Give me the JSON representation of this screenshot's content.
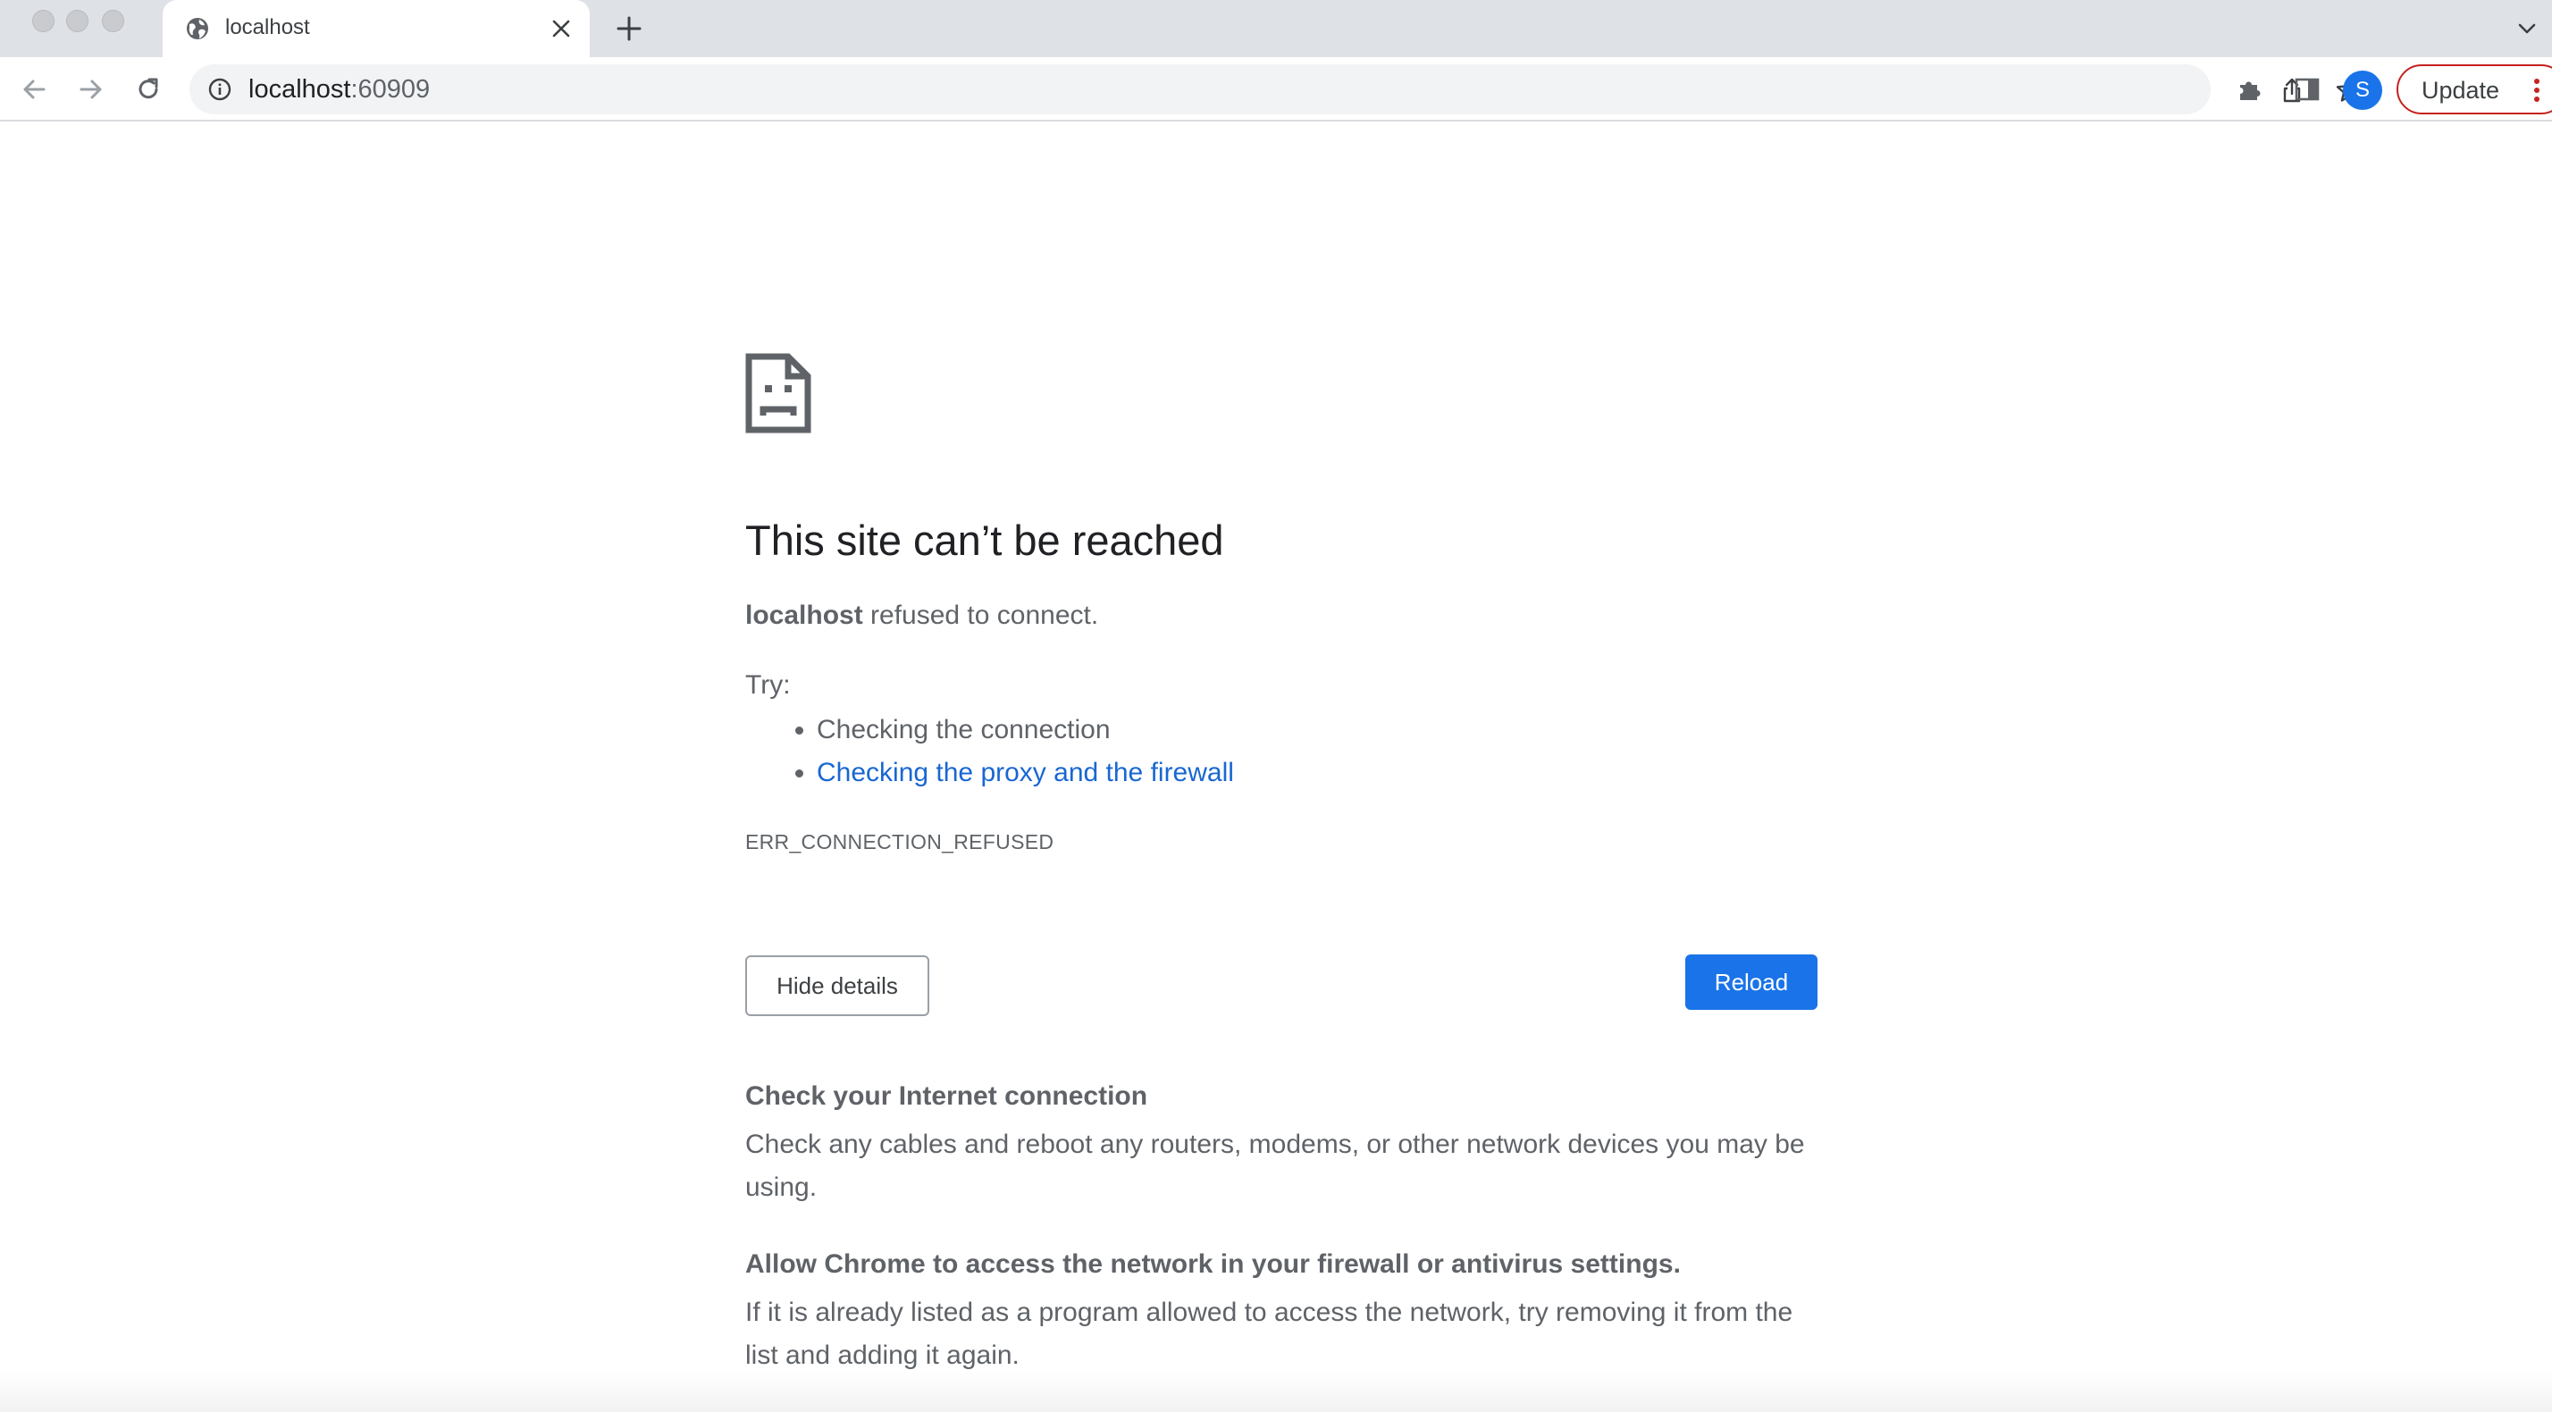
{
  "browser": {
    "tab": {
      "title": "localhost",
      "favicon": "globe-icon",
      "close_icon": "close-icon"
    },
    "new_tab_icon": "plus-icon",
    "tab_search_icon": "chevron-down-icon",
    "toolbar": {
      "back_icon": "back-arrow-icon",
      "forward_icon": "forward-arrow-icon",
      "reload_icon": "reload-icon",
      "url_host": "localhost",
      "url_port": ":60909",
      "info_icon": "info-icon",
      "share_icon": "share-icon",
      "bookmark_icon": "star-icon",
      "extensions_icon": "puzzle-icon",
      "side_panel_icon": "side-panel-icon",
      "profile_initial": "S",
      "update_label": "Update",
      "menu_icon": "kebab-menu-icon"
    },
    "colors": {
      "accent": "#1a73e8",
      "update_border": "#c5221f",
      "link": "#1967d2"
    }
  },
  "error_page": {
    "icon": "sad-document-icon",
    "title": "This site can’t be reached",
    "summary_host": "localhost",
    "summary_rest": " refused to connect.",
    "try_label": "Try:",
    "suggestions": [
      "Checking the connection",
      "Checking the proxy and the firewall"
    ],
    "error_code": "ERR_CONNECTION_REFUSED",
    "hide_details_label": "Hide details",
    "reload_label": "Reload",
    "details": [
      {
        "heading": "Check your Internet connection",
        "body": "Check any cables and reboot any routers, modems, or other network devices you may be using."
      },
      {
        "heading": "Allow Chrome to access the network in your firewall or antivirus settings.",
        "body": "If it is already listed as a program allowed to access the network, try removing it from the list and adding it again."
      }
    ]
  }
}
